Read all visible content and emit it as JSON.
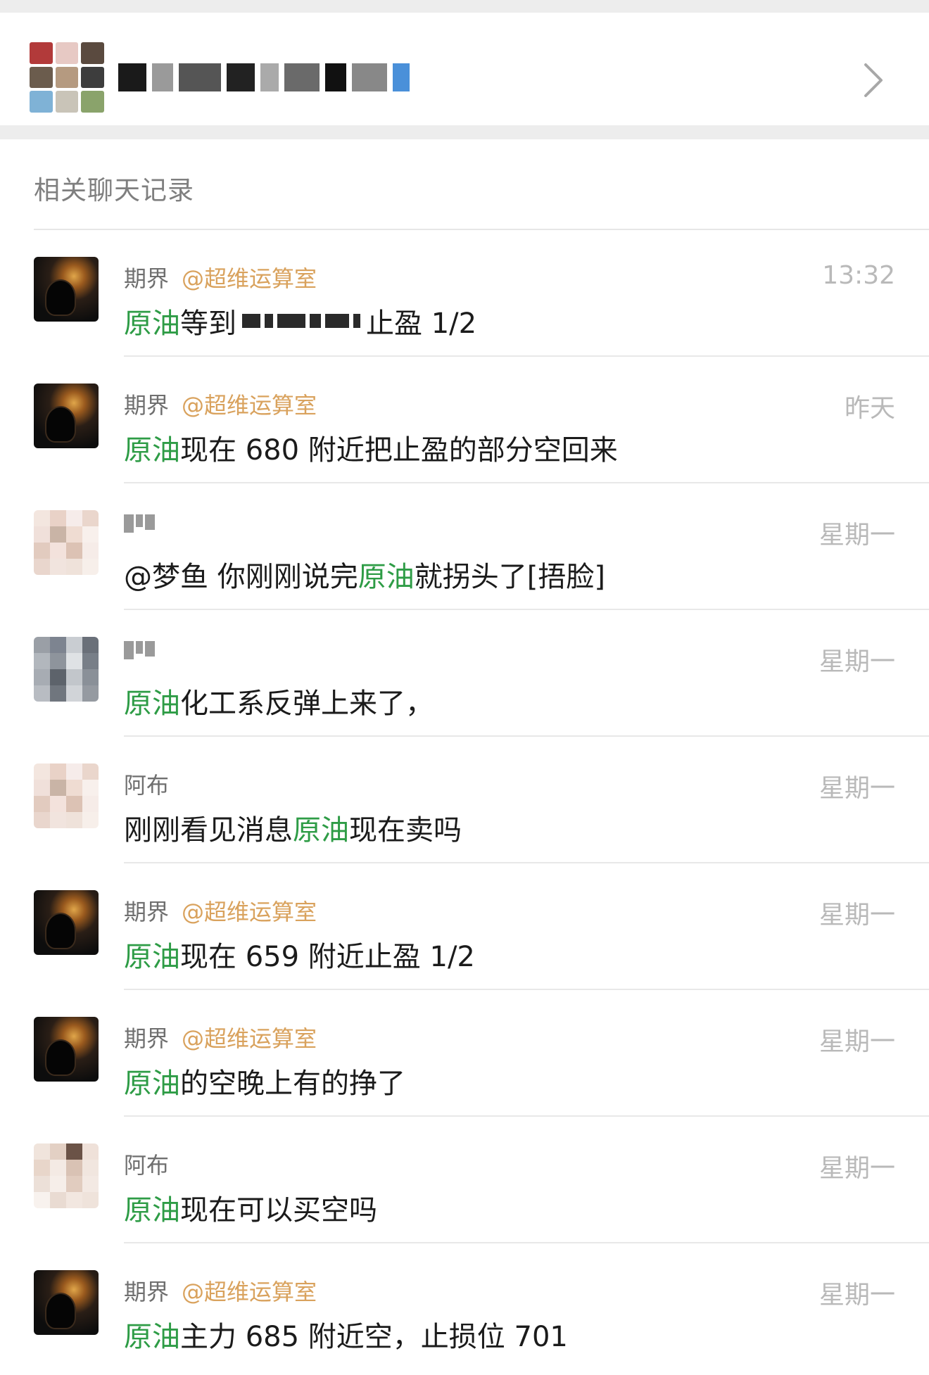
{
  "section_title": "相关聊天记录",
  "messages": [
    {
      "sender": "期界",
      "tag": "@超维运算室",
      "time": "13:32",
      "keyword": "原油",
      "before": "",
      "after": "等到",
      "tail": "止盈 1/2",
      "redacted": true,
      "avatar": "dark"
    },
    {
      "sender": "期界",
      "tag": "@超维运算室",
      "time": "昨天",
      "keyword": "原油",
      "before": "",
      "after": "现在 680 附近把止盈的部分空回来",
      "tail": "",
      "redacted": false,
      "avatar": "dark"
    },
    {
      "sender": "",
      "tag": "",
      "time": "星期一",
      "keyword": "原油",
      "before": "@梦鱼 你刚刚说完",
      "after": "就拐头了[捂脸]",
      "tail": "",
      "redacted": false,
      "avatar": "pix1"
    },
    {
      "sender": "",
      "tag": "",
      "time": "星期一",
      "keyword": "原油",
      "before": "",
      "after": "化工系反弹上来了，",
      "tail": "",
      "redacted": false,
      "avatar": "pix2"
    },
    {
      "sender": "阿布",
      "tag": "",
      "time": "星期一",
      "keyword": "原油",
      "before": "刚刚看见消息 ",
      "after": "现在卖吗",
      "tail": "",
      "redacted": false,
      "avatar": "pix1"
    },
    {
      "sender": "期界",
      "tag": "@超维运算室",
      "time": "星期一",
      "keyword": "原油",
      "before": "",
      "after": "现在 659 附近止盈 1/2",
      "tail": "",
      "redacted": false,
      "avatar": "dark"
    },
    {
      "sender": "期界",
      "tag": "@超维运算室",
      "time": "星期一",
      "keyword": "原油",
      "before": "",
      "after": "的空晚上有的挣了",
      "tail": "",
      "redacted": false,
      "avatar": "dark"
    },
    {
      "sender": "阿布",
      "tag": "",
      "time": "星期一",
      "keyword": "原油",
      "before": "",
      "after": "现在可以买空吗",
      "tail": "",
      "redacted": false,
      "avatar": "pix3"
    },
    {
      "sender": "期界",
      "tag": "@超维运算室",
      "time": "星期一",
      "keyword": "原油",
      "before": "",
      "after": "主力 685 附近空，止损位 701",
      "tail": "",
      "redacted": false,
      "avatar": "dark"
    }
  ],
  "colors": {
    "keyword": "#2e9c46",
    "tag": "#d9a25d",
    "time": "#b9b9b9"
  },
  "icons": {
    "header_chevron": "chevron-right-icon"
  }
}
